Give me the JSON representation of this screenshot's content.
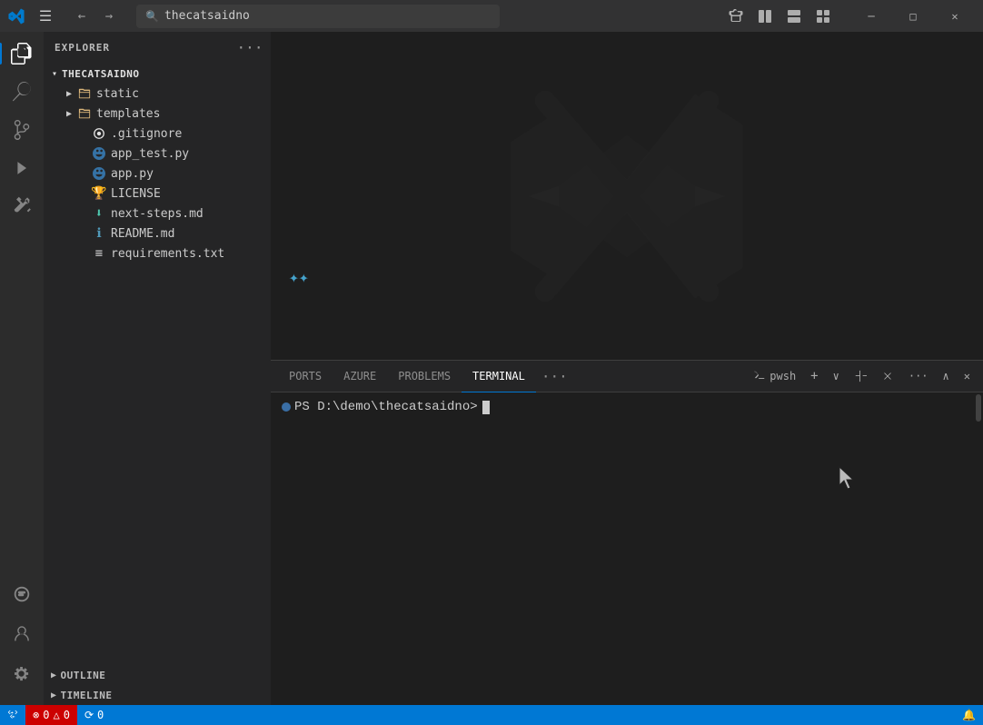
{
  "titlebar": {
    "search_placeholder": "thecatsaidno",
    "nav_back_label": "←",
    "nav_forward_label": "→",
    "menu_label": "☰",
    "extensions_label": "⊞",
    "layout_label": "▣",
    "layout2_label": "◫",
    "grid_label": "⊞",
    "minimize_label": "─",
    "maximize_label": "□",
    "close_label": "✕"
  },
  "activity_bar": {
    "items": [
      {
        "id": "explorer",
        "icon": "📄",
        "label": "Explorer",
        "active": true
      },
      {
        "id": "search",
        "icon": "🔍",
        "label": "Search",
        "active": false
      },
      {
        "id": "source-control",
        "icon": "⎇",
        "label": "Source Control",
        "active": false
      },
      {
        "id": "run",
        "icon": "▷",
        "label": "Run and Debug",
        "active": false
      },
      {
        "id": "extensions",
        "icon": "⊞",
        "label": "Extensions",
        "active": false
      }
    ],
    "bottom_items": [
      {
        "id": "remote",
        "icon": "⊡",
        "label": "Remote Explorer",
        "active": false
      },
      {
        "id": "account",
        "icon": "👤",
        "label": "Account",
        "active": false
      },
      {
        "id": "settings",
        "icon": "⚙",
        "label": "Settings",
        "active": false
      }
    ]
  },
  "sidebar": {
    "title": "EXPLORER",
    "more_actions": "···",
    "file_tree": {
      "root": {
        "name": "THECATSAIDNO",
        "expanded": true
      },
      "items": [
        {
          "id": "static",
          "name": "static",
          "type": "folder",
          "expanded": false,
          "indent": 1,
          "icon": "📁"
        },
        {
          "id": "templates",
          "name": "templates",
          "type": "folder",
          "expanded": false,
          "indent": 1,
          "icon": "📁"
        },
        {
          "id": "gitignore",
          "name": ".gitignore",
          "type": "file",
          "indent": 1,
          "icon": "🔧",
          "icon_color": "#e2e2e2"
        },
        {
          "id": "app_test",
          "name": "app_test.py",
          "type": "file",
          "indent": 1,
          "icon": "🐍",
          "icon_color": "#3572A5"
        },
        {
          "id": "app_py",
          "name": "app.py",
          "type": "file",
          "indent": 1,
          "icon": "🐍",
          "icon_color": "#3572A5"
        },
        {
          "id": "license",
          "name": "LICENSE",
          "type": "file",
          "indent": 1,
          "icon": "🏆",
          "icon_color": "#e8c05a"
        },
        {
          "id": "next_steps",
          "name": "next-steps.md",
          "type": "file",
          "indent": 1,
          "icon": "⬇",
          "icon_color": "#4ec9b0"
        },
        {
          "id": "readme",
          "name": "README.md",
          "type": "file",
          "indent": 1,
          "icon": "ℹ",
          "icon_color": "#519aba"
        },
        {
          "id": "requirements",
          "name": "requirements.txt",
          "type": "file",
          "indent": 1,
          "icon": "≡",
          "icon_color": "#cccccc"
        }
      ]
    }
  },
  "sections": {
    "outline": {
      "label": "OUTLINE",
      "expanded": false
    },
    "timeline": {
      "label": "TIMELINE",
      "expanded": false
    }
  },
  "terminal": {
    "tabs": [
      {
        "id": "ports",
        "label": "PORTS",
        "active": false
      },
      {
        "id": "azure",
        "label": "AZURE",
        "active": false
      },
      "SEPARATOR",
      {
        "id": "problems",
        "label": "PROBLEMS",
        "active": false
      },
      "SEPARATOR",
      {
        "id": "terminal",
        "label": "TERMINAL",
        "active": true
      }
    ],
    "more_label": "···",
    "shell_label": "pwsh",
    "add_label": "+",
    "split_label": "split",
    "kill_label": "kill",
    "more_actions_label": "···",
    "collapse_label": "∧",
    "close_label": "✕",
    "prompt": "PS D:\\demo\\thecatsaidno> "
  },
  "status_bar": {
    "remote_label": "⌂ 0",
    "errors_label": "⊗ 0",
    "warnings_label": "△ 0",
    "info_label": "⟳ 0",
    "bell_label": "🔔"
  }
}
